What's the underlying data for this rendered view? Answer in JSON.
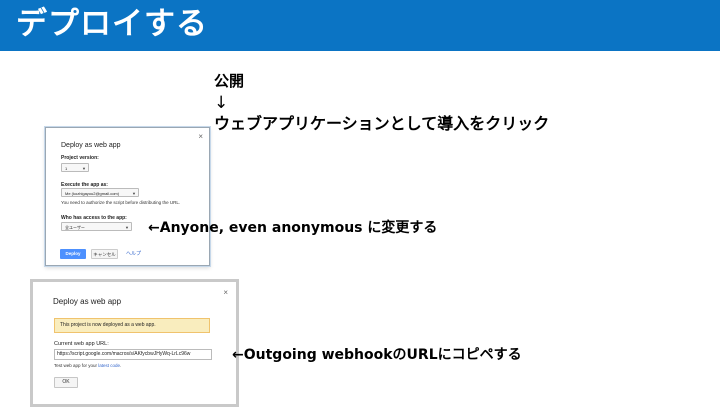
{
  "slide": {
    "title": "デプロイする"
  },
  "colors": {
    "header": "#0b74c4",
    "deploy_button": "#4d90fe",
    "banner": "#f9edbe",
    "link": "#3366cc"
  },
  "notes": {
    "public": "公開",
    "arrow": "↓",
    "import_click": "ウェブアプリケーションとして導入をクリック",
    "anyone": "←Anyone, even anonymous に変更する",
    "copy_url": "←Outgoing webhookのURLにコピペする"
  },
  "dialog1": {
    "title": "Deploy as web app",
    "close": "×",
    "project_version_label": "Project version:",
    "project_version_value": "1",
    "execute_label": "Execute the app as:",
    "execute_value": "Me (kozhigayou2@gmail.com)",
    "authorize_note": "You need to authorize the script before distributing the URL.",
    "access_label": "Who has access to the app:",
    "access_value": "全ユーザー",
    "deploy_button": "Deploy",
    "cancel_button": "キャンセル",
    "help_link": "ヘルプ"
  },
  "dialog2": {
    "title": "Deploy as web app",
    "close": "×",
    "banner": "This project is now deployed as a web app.",
    "url_label": "Current web app URL:",
    "url_value": "https://script.google.com/macros/s/AKfycbwJHyWq-LrLc96w",
    "test_text": "Test web app for your ",
    "test_link": "latest code",
    "test_end": ".",
    "ok_button": "OK"
  }
}
